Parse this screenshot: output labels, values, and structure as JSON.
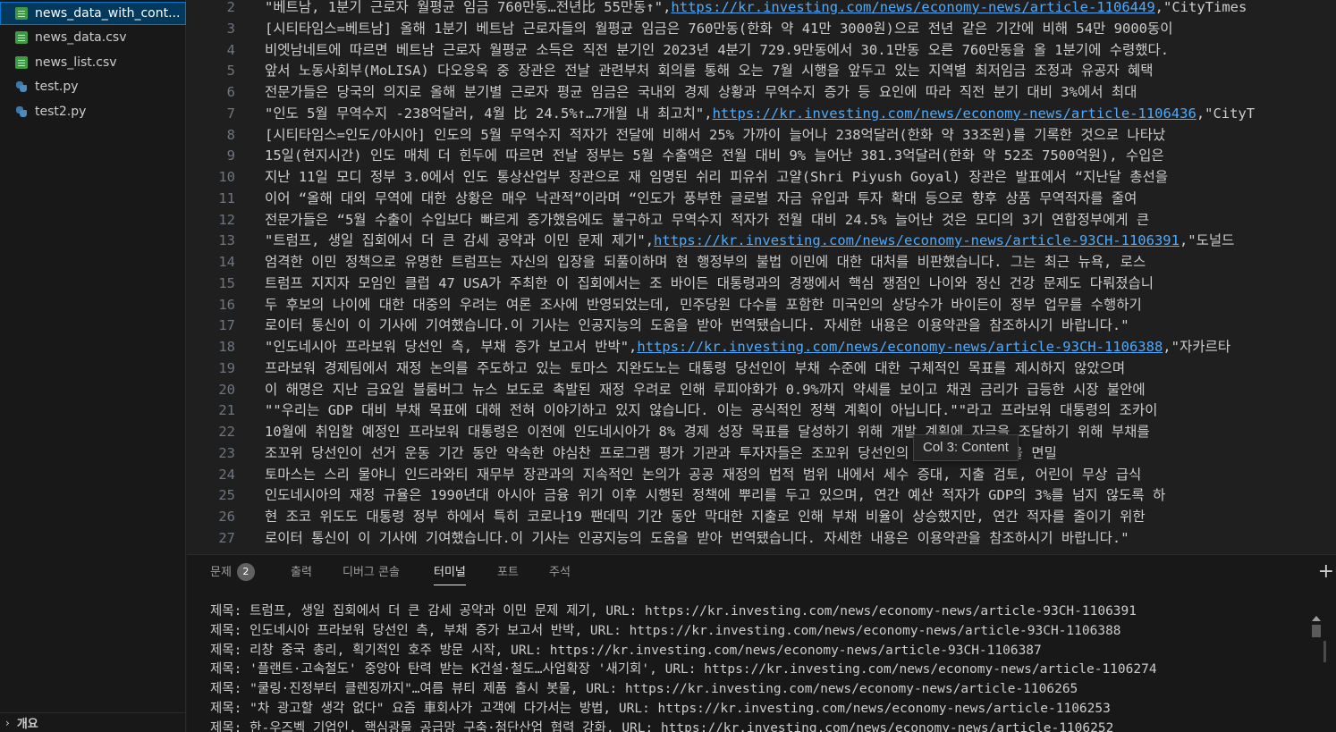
{
  "explorer": {
    "files": [
      {
        "name": "news_data_with_content.csv",
        "display": "news_data_with_cont...",
        "icon": "csv-file-icon",
        "active": true
      },
      {
        "name": "news_data.csv",
        "display": "news_data.csv",
        "icon": "csv-file-icon"
      },
      {
        "name": "news_list.csv",
        "display": "news_list.csv",
        "icon": "csv-file-icon"
      },
      {
        "name": "test.py",
        "display": "test.py",
        "icon": "python-file-icon"
      },
      {
        "name": "test2.py",
        "display": "test2.py",
        "icon": "python-file-icon"
      }
    ],
    "outline_label": "개요",
    "outline_chevron": "›"
  },
  "editor": {
    "lines": [
      {
        "num": "2",
        "pre": "\"베트남, 1분기 근로자 월평균 임금 760만동…전년比 55만동↑\",",
        "url": "https://kr.investing.com/news/economy-news/article-1106449",
        "post": ",\"CityTimes"
      },
      {
        "num": "3",
        "pre": "[시티타임스=베트남] 올해 1분기 베트남 근로자들의 월평균 임금은 760만동(한화 약 41만 3000원)으로 전년 같은 기간에 비해 54만 9000동이",
        "url": "",
        "post": ""
      },
      {
        "num": "4",
        "pre": "비엣남네트에 따르면 베트남 근로자 월평균 소득은 직전 분기인 2023년 4분기 729.9만동에서 30.1만동 오른 760만동을 올 1분기에 수령했다.",
        "url": "",
        "post": ""
      },
      {
        "num": "5",
        "pre": "앞서 노동사회부(MoLISA) 다오응옥 중 장관은 전날 관련부처 회의를 통해 오는 7월 시행을 앞두고 있는 지역별 최저임금 조정과 유공자 혜택",
        "url": "",
        "post": ""
      },
      {
        "num": "6",
        "pre": "전문가들은 당국의 의지로 올해 분기별 근로자 평균 임금은 국내외 경제 상황과 무역수지 증가 등 요인에 따라 직전 분기 대비 3%에서 최대",
        "url": "",
        "post": ""
      },
      {
        "num": "7",
        "pre": "\"인도 5월 무역수지 -238억달러, 4월 比 24.5%↑…7개월 내 최고치\",",
        "url": "https://kr.investing.com/news/economy-news/article-1106436",
        "post": ",\"CityT"
      },
      {
        "num": "8",
        "pre": "[시티타임스=인도/아시아] 인도의 5월 무역수지 적자가 전달에 비해서 25% 가까이 늘어나 238억달러(한화 약 33조원)를 기록한 것으로 나타났",
        "url": "",
        "post": ""
      },
      {
        "num": "9",
        "pre": "15일(현지시간) 인도 매체 더 힌두에 따르면 전날 정부는 5월 수출액은 전월 대비 9% 늘어난 381.3억달러(한화 약 52조 7500억원), 수입은",
        "url": "",
        "post": ""
      },
      {
        "num": "10",
        "pre": "지난 11일 모디 정부 3.0에서 인도 통상산업부 장관으로 재 임명된 쉬리 피유쉬 고얄(Shri Piyush Goyal) 장관은 발표에서 “지난달 총선을",
        "url": "",
        "post": ""
      },
      {
        "num": "11",
        "pre": "이어 “올해 대외 무역에 대한 상황은 매우 낙관적”이라며 “인도가 풍부한 글로벌 자금 유입과 투자 확대 등으로 향후 상품 무역적자를 줄여",
        "url": "",
        "post": ""
      },
      {
        "num": "12",
        "pre": "전문가들은 “5월 수출이 수입보다 빠르게 증가했음에도 불구하고 무역수지 적자가 전월 대비 24.5% 늘어난 것은 모디의 3기 연합정부에게 큰",
        "url": "",
        "post": ""
      },
      {
        "num": "13",
        "pre": "\"트럼프, 생일 집회에서 더 큰 감세 공약과 이민 문제 제기\",",
        "url": "https://kr.investing.com/news/economy-news/article-93CH-1106391",
        "post": ",\"도널드"
      },
      {
        "num": "14",
        "pre": "엄격한 이민 정책으로 유명한 트럼프는 자신의 입장을 되풀이하며 현 행정부의 불법 이민에 대한 대처를 비판했습니다. 그는 최근 뉴욕, 로스",
        "url": "",
        "post": ""
      },
      {
        "num": "15",
        "pre": "트럼프 지지자 모임인 클럽 47 USA가 주최한 이 집회에서는 조 바이든 대통령과의 경쟁에서 핵심 쟁점인 나이와 정신 건강 문제도 다뤄졌습니",
        "url": "",
        "post": ""
      },
      {
        "num": "16",
        "pre": "두 후보의 나이에 대한 대중의 우려는 여론 조사에 반영되었는데, 민주당원 다수를 포함한 미국인의 상당수가 바이든이 정부 업무를 수행하기",
        "url": "",
        "post": ""
      },
      {
        "num": "17",
        "pre": "로이터 통신이 이 기사에 기여했습니다.이 기사는 인공지능의 도움을 받아 번역됐습니다. 자세한 내용은 이용약관을 참조하시기 바랍니다.\"",
        "url": "",
        "post": ""
      },
      {
        "num": "18",
        "pre": "\"인도네시아 프라보워 당선인 측, 부채 증가 보고서 반박\",",
        "url": "https://kr.investing.com/news/economy-news/article-93CH-1106388",
        "post": ",\"자카르타"
      },
      {
        "num": "19",
        "pre": "프라보워 경제팀에서 재정 논의를 주도하고 있는 토마스 지완도노는 대통령 당선인이 부채 수준에 대한 구체적인 목표를 제시하지 않았으며 ",
        "url": "",
        "post": ""
      },
      {
        "num": "20",
        "pre": "이 해명은 지난 금요일 블룸버그 뉴스 보도로 촉발된 재정 우려로 인해 루피아화가 0.9%까지 약세를 보이고 채권 금리가 급등한 시장 불안에",
        "url": "",
        "post": ""
      },
      {
        "num": "21",
        "pre": "\"\"우리는 GDP 대비 부채 목표에 대해 전혀 이야기하고 있지 않습니다. 이는 공식적인 정책 계획이 아닙니다.\"\"라고 프라보워 대통령의 조카이",
        "url": "",
        "post": ""
      },
      {
        "num": "22",
        "pre": "10월에 취임할 예정인 프라보워 대통령은 이전에 인도네시아가 8% 경제 성장 목표를 달성하기 위해 개발 계획에 자금을 조달하기 위해 부채를",
        "url": "",
        "post": ""
      },
      {
        "num": "23",
        "pre": "조꼬위 당선인이 선거 운동 기간 동안 약속한 야심찬 프로그램 평가 기관과 투자자들은 조꼬위 당선인의 재정 접근 방식을 면밀",
        "url": "",
        "post": ""
      },
      {
        "num": "24",
        "pre": "토마스는 스리 물야니 인드라와티 재무부 장관과의 지속적인 논의가 공공 재정의 법적 범위 내에서 세수 증대, 지출 검토, 어린이 무상 급식",
        "url": "",
        "post": ""
      },
      {
        "num": "25",
        "pre": "인도네시아의 재정 규율은 1990년대 아시아 금융 위기 이후 시행된 정책에 뿌리를 두고 있으며, 연간 예산 적자가 GDP의 3%를 넘지 않도록 하",
        "url": "",
        "post": ""
      },
      {
        "num": "26",
        "pre": "현 조코 위도도 대통령 정부 하에서 특히 코로나19 팬데믹 기간 동안 막대한 지출로 인해 부채 비율이 상승했지만, 연간 적자를 줄이기 위한",
        "url": "",
        "post": ""
      },
      {
        "num": "27",
        "pre": "로이터 통신이 이 기사에 기여했습니다.이 기사는 인공지능의 도움을 받아 번역됐습니다. 자세한 내용은 이용약관을 참조하시기 바랍니다.\"",
        "url": "",
        "post": ""
      }
    ],
    "hover_tooltip": "Col 3: Content"
  },
  "panel": {
    "tabs": [
      {
        "label": "문제",
        "badge": "2"
      },
      {
        "label": "출력"
      },
      {
        "label": "디버그 콘솔"
      },
      {
        "label": "터미널",
        "active": true
      },
      {
        "label": "포트"
      },
      {
        "label": "주석"
      }
    ],
    "add_label": "+",
    "terminal_lines": [
      "제목: 트럼프, 생일 집회에서 더 큰 감세 공약과 이민 문제 제기, URL: https://kr.investing.com/news/economy-news/article-93CH-1106391",
      "제목: 인도네시아 프라보워 당선인 측, 부채 증가 보고서 반박, URL: https://kr.investing.com/news/economy-news/article-93CH-1106388",
      "제목: 리창 중국 총리, 획기적인 호주 방문 시작, URL: https://kr.investing.com/news/economy-news/article-93CH-1106387",
      "제목: '플랜트·고속철도' 중앙아 탄력 받는 K건설·철도…사업확장 '새기회', URL: https://kr.investing.com/news/economy-news/article-1106274",
      "제목: \"쿨링·진정부터 클렌징까지\"…여름 뷰티 제품 출시 봇물, URL: https://kr.investing.com/news/economy-news/article-1106265",
      "제목: \"차 광고할 생각 없다\" 요즘 車회사가 고객에 다가서는 방법, URL: https://kr.investing.com/news/economy-news/article-1106253",
      "제목: 한-우즈벡 기업인, 핵심광물 공급망 구축·첨단산업 협력 강화, URL: https://kr.investing.com/news/economy-news/article-1106252"
    ]
  }
}
